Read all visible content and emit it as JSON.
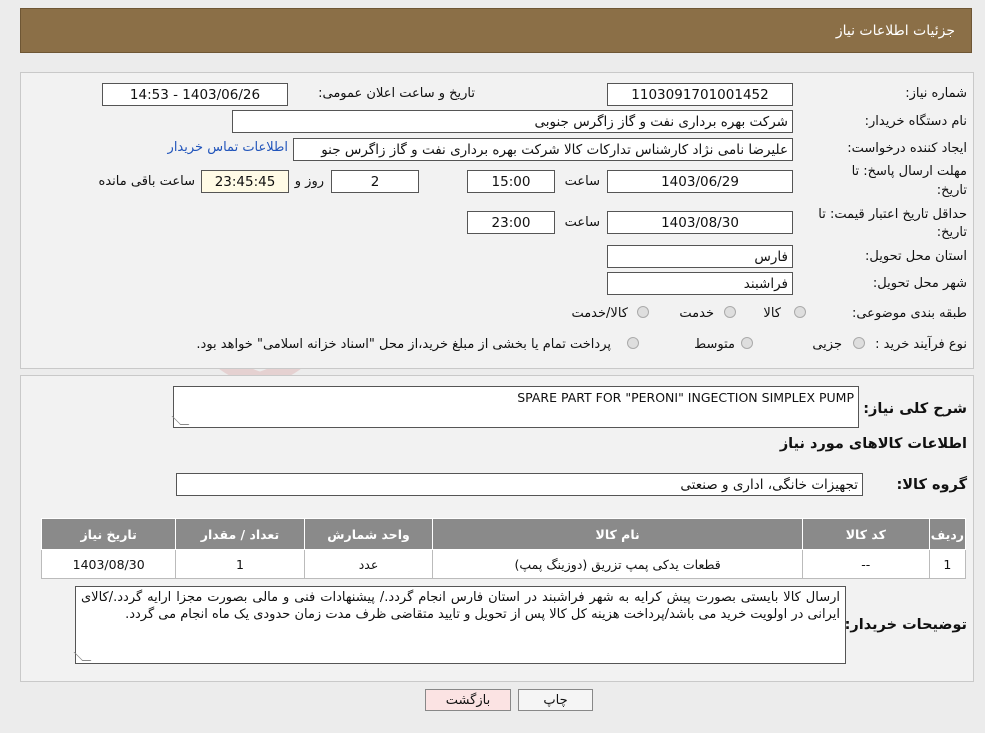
{
  "header": {
    "title": "جزئیات اطلاعات نیاز"
  },
  "watermark": {
    "text": "AriaTender.neT"
  },
  "form": {
    "need_number_label": "شماره نیاز:",
    "need_number": "1103091701001452",
    "announce_label": "تاریخ و ساعت اعلان عمومی:",
    "announce_value": "1403/06/26 - 14:53",
    "buyer_org_label": "نام دستگاه خریدار:",
    "buyer_org": "شرکت بهره برداری نفت و گاز زاگرس جنوبی",
    "requester_label": "ایجاد کننده درخواست:",
    "requester": "علیرضا نامی نژاد کارشناس تدارکات کالا شرکت بهره برداری نفت و گاز زاگرس جنو",
    "contact_link": "اطلاعات تماس خریدار",
    "deadline_label_1": "مهلت ارسال پاسخ: تا",
    "deadline_label_2": "تاریخ:",
    "deadline_date": "1403/06/29",
    "time_label": "ساعت",
    "deadline_time": "15:00",
    "days_value": "2",
    "days_label": "روز و",
    "remaining_value": "23:45:45",
    "remaining_label": "ساعت باقی مانده",
    "validity_label_1": "حداقل تاریخ اعتبار قیمت: تا",
    "validity_label_2": "تاریخ:",
    "validity_date": "1403/08/30",
    "validity_time": "23:00",
    "province_label": "استان محل تحویل:",
    "province": "فارس",
    "city_label": "شهر محل تحویل:",
    "city": "فراشبند",
    "category_label": "طبقه بندی موضوعی:",
    "category_options": [
      "کالا",
      "خدمت",
      "کالا/خدمت"
    ],
    "process_label": "نوع فرآیند خرید :",
    "process_options": [
      "جزیی",
      "متوسط"
    ],
    "process_note": "پرداخت تمام یا بخشی از مبلغ خرید،از محل \"اسناد خزانه اسلامی\" خواهد بود."
  },
  "details": {
    "description_label": "شرح کلی نیاز:",
    "description": "SPARE PART FOR \"PERONI\" INGECTION SIMPLEX PUMP",
    "items_title": "اطلاعات کالاهای مورد نیاز",
    "group_label": "گروه کالا:",
    "group_value": "تجهیزات خانگی، اداری و صنعتی",
    "table": {
      "headers": [
        "ردیف",
        "کد کالا",
        "نام کالا",
        "واحد شمارش",
        "تعداد / مقدار",
        "تاریخ نیاز"
      ],
      "rows": [
        [
          "1",
          "--",
          "قطعات یدکی پمپ تزریق (دوزینگ پمپ)",
          "عدد",
          "1",
          "1403/08/30"
        ]
      ]
    },
    "buyer_notes_label": "توضیحات خریدار:",
    "buyer_notes": "ارسال کالا بایستی بصورت پیش کرایه به شهر فراشبند در استان فارس انجام گردد./ پیشنهادات فنی و مالی بصورت مجزا ارایه گردد./کالای ایرانی در اولویت خرید می باشد/پرداخت هزینه کل کالا پس از تحویل و تایید متقاضی ظرف مدت زمان حدودی یک ماه انجام می گردد."
  },
  "buttons": {
    "print": "چاپ",
    "back": "بازگشت"
  },
  "colors": {
    "header_bg": "#8b6f47",
    "table_header_bg": "#8a8a8a",
    "back_button_bg": "#fbe3e3"
  }
}
